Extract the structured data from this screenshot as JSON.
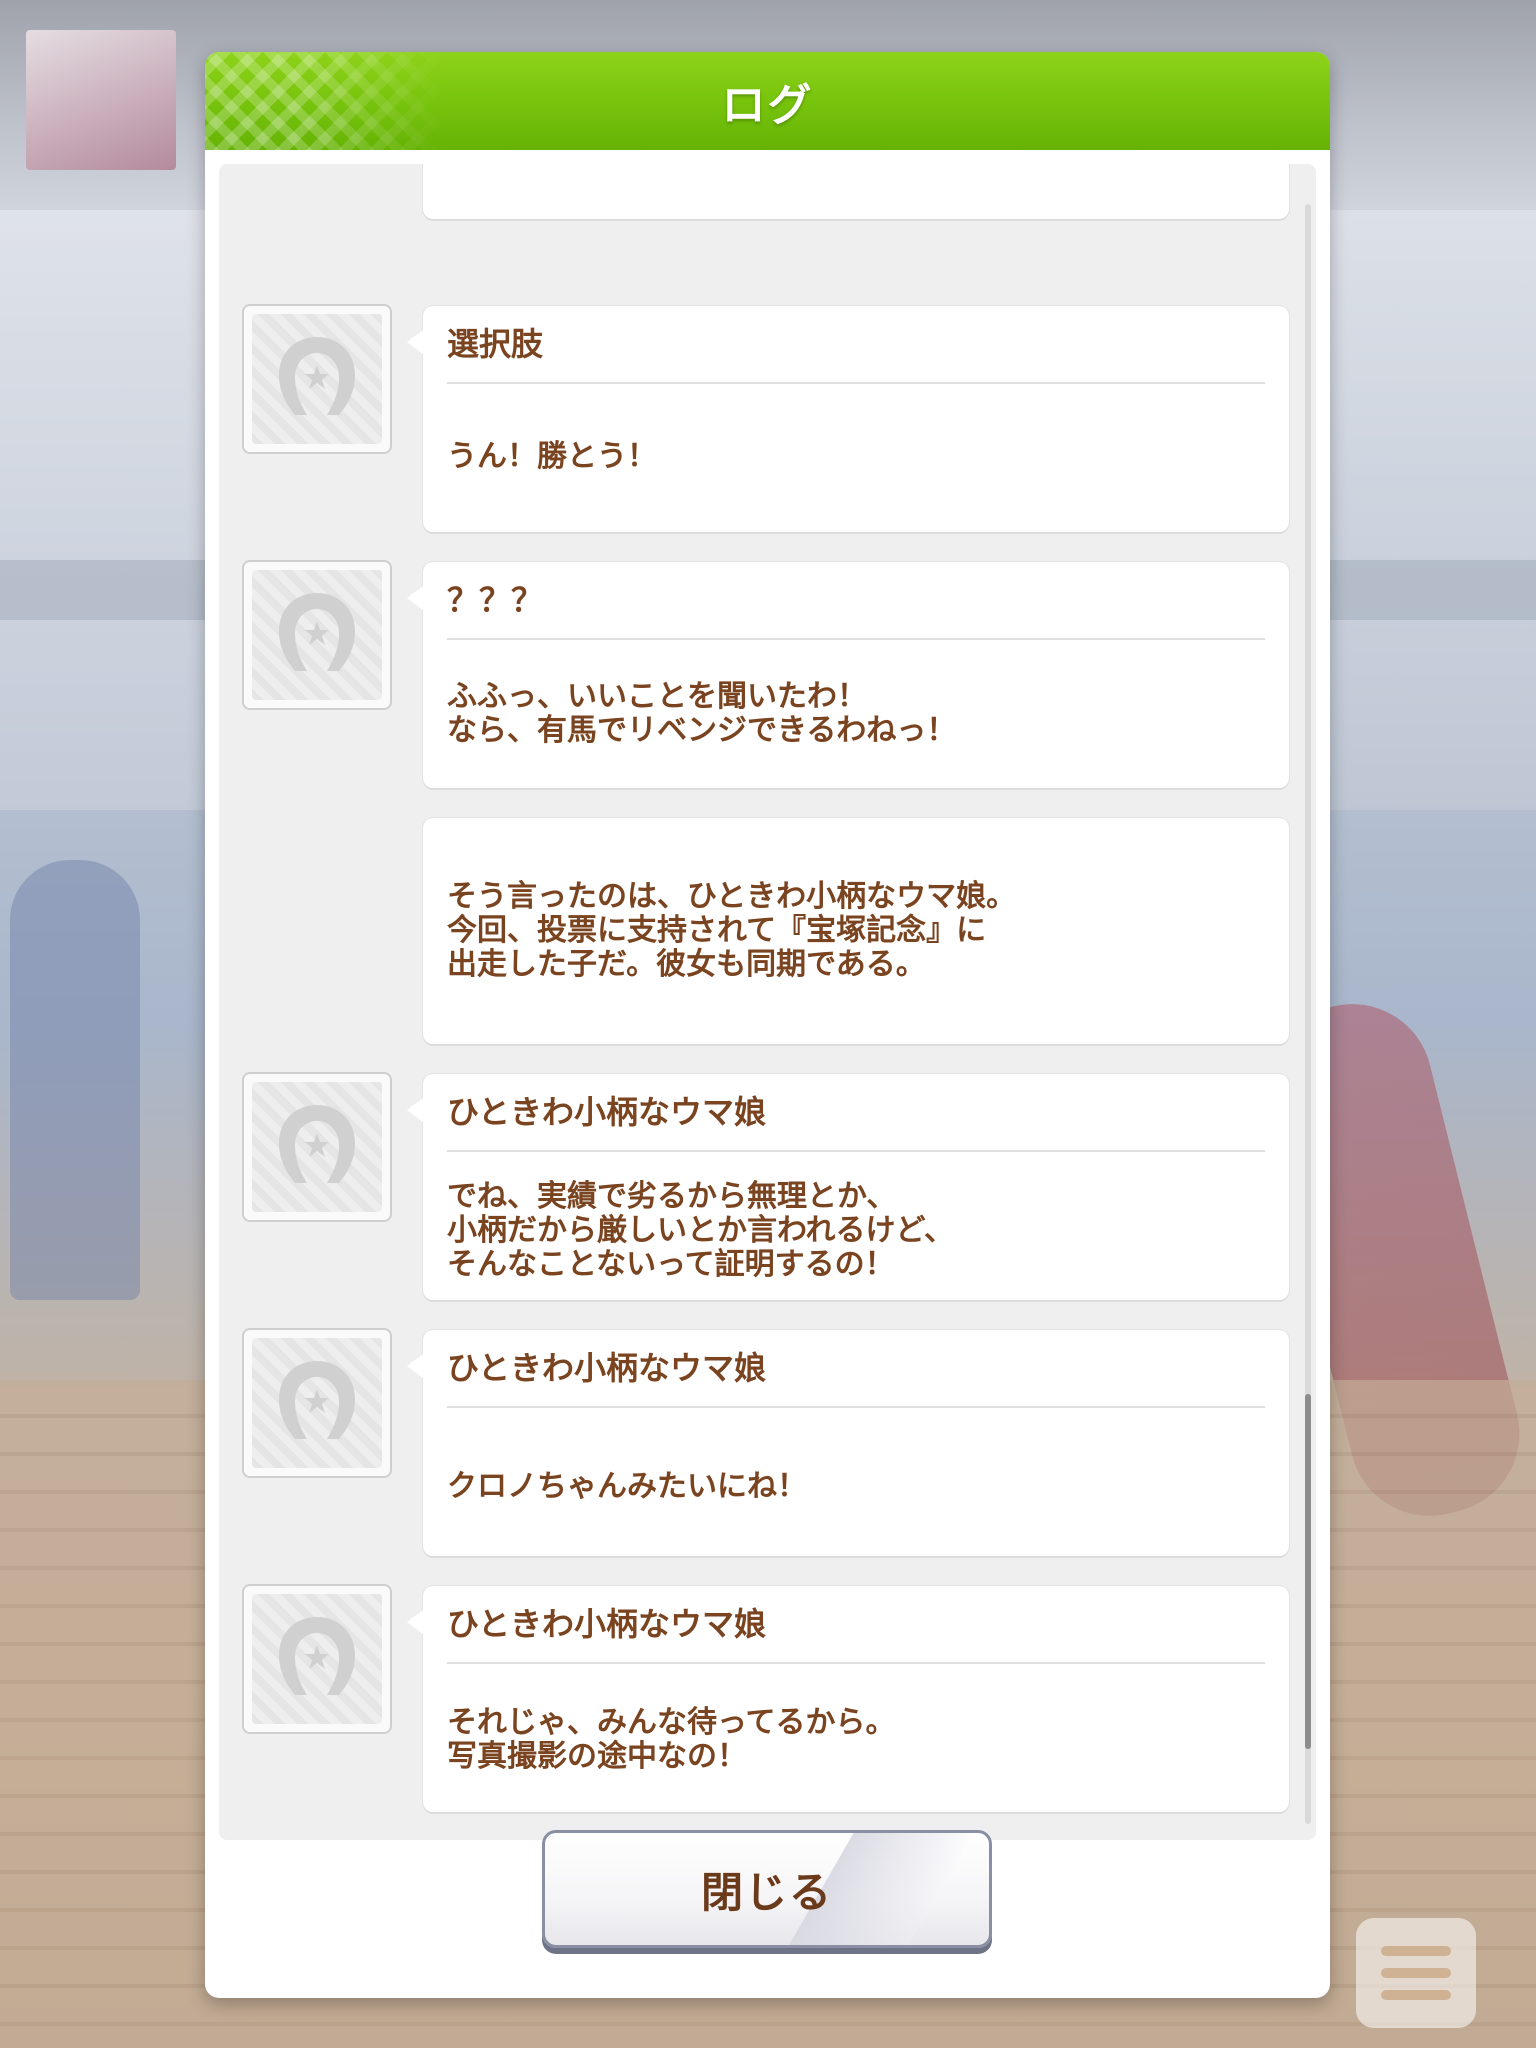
{
  "dialog": {
    "title": "ログ",
    "close_label": "閉じる"
  },
  "log_entries": [
    {
      "speaker": "",
      "text": "…"
    },
    {
      "speaker": "選択肢",
      "text": "うん！勝とう！"
    },
    {
      "speaker": "？？？",
      "text": "ふふっ、いいことを聞いたわ！\nなら、有馬でリベンジできるわねっ！"
    },
    {
      "speaker": "",
      "text": "そう言ったのは、ひときわ小柄なウマ娘。\n今回、投票に支持されて『宝塚記念』に\n出走した子だ。彼女も同期である。"
    },
    {
      "speaker": "ひときわ小柄なウマ娘",
      "text": "でね、実績で劣るから無理とか、\n小柄だから厳しいとか言われるけど、\nそんなことないって証明するの！"
    },
    {
      "speaker": "ひときわ小柄なウマ娘",
      "text": "クロノちゃんみたいにね！"
    },
    {
      "speaker": "ひときわ小柄なウマ娘",
      "text": "それじゃ、みんな待ってるから。\n写真撮影の途中なの！"
    }
  ],
  "colors": {
    "header_green": "#76c20c",
    "text_brown": "#7a4420"
  },
  "icons": {
    "avatar": "horseshoe-star-icon",
    "menu": "menu-lines-icon"
  }
}
